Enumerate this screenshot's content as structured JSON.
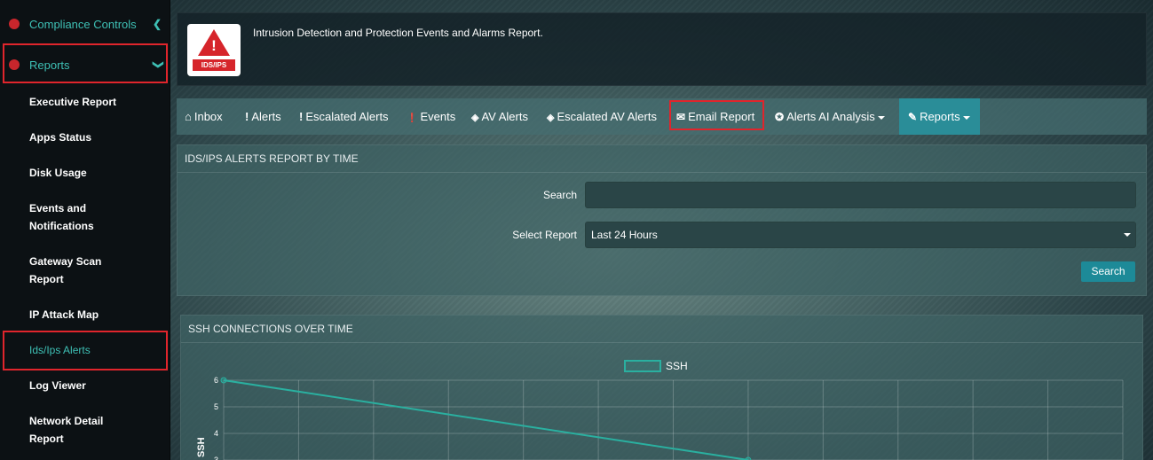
{
  "sidebar": {
    "compliance": "Compliance Controls",
    "reports": "Reports",
    "items": [
      "Executive Report",
      "Apps Status",
      "Disk Usage",
      "Events and",
      "Notifications",
      "Gateway Scan",
      "Report",
      "IP Attack Map",
      "Ids/Ips Alerts",
      "Log Viewer",
      "Network Detail",
      "Report"
    ]
  },
  "header": {
    "icon_caption": "IDS/IPS",
    "title": "Intrusion Detection and Protection Events and Alarms Report."
  },
  "tabs": [
    {
      "icon": "⌂",
      "label": "Inbox"
    },
    {
      "icon": "!",
      "label": "Alerts"
    },
    {
      "icon": "!",
      "label": "Escalated Alerts"
    },
    {
      "icon": "❗",
      "label": "Events"
    },
    {
      "icon": "◈",
      "label": "AV Alerts"
    },
    {
      "icon": "◈",
      "label": "Escalated AV Alerts"
    },
    {
      "icon": "✉",
      "label": "Email Report"
    },
    {
      "icon": "✪",
      "label": "Alerts AI Analysis"
    },
    {
      "icon": "✎",
      "label": "Reports"
    }
  ],
  "filter_panel": {
    "title": "IDS/IPS ALERTS REPORT BY TIME",
    "search_label": "Search",
    "search_value": "",
    "select_label": "Select Report",
    "select_value": "Last 24 Hours",
    "search_button": "Search"
  },
  "chart_panel": {
    "title": "SSH CONNECTIONS OVER TIME"
  },
  "chart_data": {
    "type": "line",
    "series": [
      {
        "name": "SSH",
        "x": [
          0,
          7
        ],
        "values": [
          6,
          3
        ]
      }
    ],
    "ylabel": "SSH",
    "y_ticks": [
      "6",
      "5",
      "4",
      "3"
    ],
    "ylim": [
      3,
      6
    ],
    "xlim": [
      0,
      12
    ],
    "grid": true,
    "legend": "top-center",
    "line_color": "#2ab0a0"
  }
}
